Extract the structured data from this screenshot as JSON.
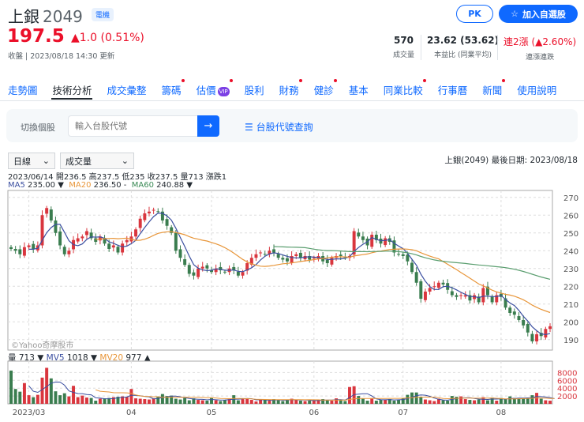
{
  "header": {
    "name": "上銀",
    "code": "2049",
    "industry": "電機",
    "price": "197.5",
    "change": "▲1.0 (0.51%)",
    "status": "收盤 | 2023/08/18 14:30 更新",
    "pk_label": "PK",
    "watchlist_label": "加入自選股"
  },
  "stats": [
    {
      "value": "570",
      "label": "成交量"
    },
    {
      "value": "23.62 (53.62)",
      "label": "本益比 (同業平均)"
    },
    {
      "value": "連2漲 (▲2.60%)",
      "label": "連漲連跌"
    }
  ],
  "tabs": [
    "走勢圖",
    "技術分析",
    "成交彙整",
    "籌碼",
    "估價",
    "股利",
    "財務",
    "健診",
    "基本",
    "同業比較",
    "行事曆",
    "新聞",
    "使用說明"
  ],
  "vip": "VIP",
  "search": {
    "label": "切換個股",
    "placeholder": "輸入台股代號",
    "go": "→",
    "lookup": "☰ 台股代號查詢"
  },
  "controls": {
    "period": "日線",
    "indicator": "成交量",
    "info": "上銀(2049)   最後日期: 2023/08/18"
  },
  "ohlc_line": "2023/06/14 開236.5 高237.5 低235 收237.5 量713 漲跌1",
  "ma": {
    "ma5_label": "MA5",
    "ma5": "235.00 ▼",
    "ma20_label": "MA20",
    "ma20": "236.50 -",
    "ma60_label": "MA60",
    "ma60": "240.88 ▼"
  },
  "vol_legend": {
    "label": "量",
    "vol": "713 ▼",
    "mv5_label": "MV5",
    "mv5": "1018 ▼",
    "mv20_label": "MV20",
    "mv20": "977 ▲"
  },
  "watermark": "©Yahoo奇摩股市",
  "colors": {
    "up": "#d9363e",
    "down": "#3a7d4f",
    "ma5": "#3b4fa0",
    "ma20": "#e8963a",
    "ma60": "#5a9e6f"
  },
  "chart_data": {
    "type": "candlestick",
    "price_ticks": [
      190,
      200,
      210,
      220,
      230,
      240,
      250,
      260,
      270
    ],
    "ylim": [
      185,
      273
    ],
    "vol_ticks": [
      2000,
      4000,
      6000,
      8000
    ],
    "vol_ylim": [
      0,
      10500
    ],
    "months": [
      {
        "label": "2023/03",
        "index": 4
      },
      {
        "label": "04",
        "index": 27
      },
      {
        "label": "05",
        "index": 45
      },
      {
        "label": "06",
        "index": 68
      },
      {
        "label": "07",
        "index": 88
      },
      {
        "label": "08",
        "index": 110
      }
    ],
    "close": [
      241,
      240,
      238,
      242,
      243,
      241,
      243,
      260,
      264,
      257,
      250,
      243,
      238,
      240,
      246,
      247,
      248,
      251,
      247,
      245,
      248,
      244,
      241,
      243,
      239,
      244,
      246,
      248,
      252,
      258,
      261,
      262,
      263,
      262,
      257,
      254,
      250,
      240,
      236,
      232,
      227,
      226,
      230,
      231,
      230,
      228,
      230,
      229,
      228,
      230,
      229,
      226,
      228,
      233,
      236,
      238,
      239,
      238,
      240,
      239,
      236,
      235,
      234,
      237,
      238,
      236,
      237,
      235,
      236,
      237,
      234,
      233,
      236,
      237,
      237,
      236,
      237,
      251,
      248,
      246,
      243,
      249,
      246,
      244,
      247,
      245,
      239,
      238,
      237,
      234,
      228,
      222,
      213,
      217,
      219,
      220,
      222,
      221,
      218,
      215,
      214,
      215,
      215,
      212,
      215,
      211,
      219,
      215,
      211,
      215,
      214,
      208,
      205,
      204,
      201,
      198,
      194,
      189,
      193,
      192,
      196,
      197.5
    ],
    "volume": [
      8500,
      3800,
      3100,
      5300,
      2200,
      1700,
      2300,
      6700,
      9200,
      6500,
      3200,
      2200,
      2700,
      1900,
      4600,
      1700,
      2100,
      1600,
      1500,
      800,
      1300,
      1400,
      1500,
      1700,
      1800,
      1900,
      1800,
      3800,
      1400,
      1300,
      1200,
      1100,
      1400,
      1900,
      2500,
      2000,
      2100,
      1300,
      1100,
      1500,
      900,
      1400,
      1000,
      900,
      800,
      1500,
      900,
      700,
      1000,
      1200,
      2200,
      900,
      1200,
      1300,
      1000,
      600,
      1100,
      1000,
      800,
      1200,
      900,
      700,
      1100,
      1300,
      1000,
      800,
      700,
      800,
      800,
      1100,
      1200,
      900,
      800,
      1400,
      900,
      700,
      4300,
      4500,
      2000,
      1300,
      800,
      1400,
      800,
      1000,
      1100,
      1200,
      800,
      1000,
      1400,
      2300,
      2900,
      2900,
      1800,
      1100,
      900,
      700,
      1300,
      900,
      800,
      2000,
      1800,
      1900,
      1200,
      1000,
      900,
      1100,
      1700,
      900,
      1600,
      800,
      1500,
      1200,
      1900,
      1500,
      1300,
      1400,
      1500,
      2200,
      2800,
      1300,
      900,
      800,
      713
    ]
  }
}
